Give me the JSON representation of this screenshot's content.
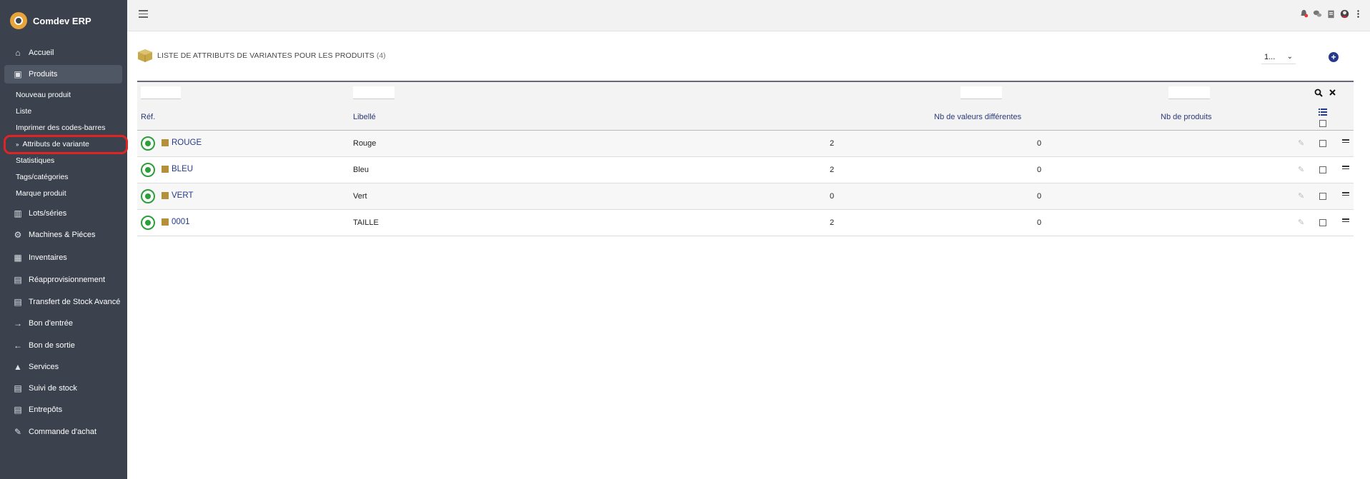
{
  "app": {
    "name": "Comdev ERP"
  },
  "sidebar": {
    "items": [
      {
        "label": "Accueil",
        "icon": "home-icon"
      },
      {
        "label": "Produits",
        "icon": "cube-icon",
        "active": true
      },
      {
        "label": "Lots/séries",
        "icon": "barcode-icon"
      },
      {
        "label": "Machines & Piéces",
        "icon": "cogs-icon"
      },
      {
        "label": "Inventaires",
        "icon": "boxes-icon"
      },
      {
        "label": "Réapprovisionnement",
        "icon": "box-open-icon"
      },
      {
        "label": "Transfert de Stock Avancé",
        "icon": "box-open-icon"
      },
      {
        "label": "Bon d'entrée",
        "icon": "arrow-right-icon"
      },
      {
        "label": "Bon de sortie",
        "icon": "arrow-left-icon"
      },
      {
        "label": "Services",
        "icon": "bell-icon"
      },
      {
        "label": "Suivi de stock",
        "icon": "box-open-icon"
      },
      {
        "label": "Entrepôts",
        "icon": "box-open-icon"
      },
      {
        "label": "Commande d'achat",
        "icon": "dolly-icon"
      }
    ],
    "sub_items": [
      {
        "label": "Nouveau produit"
      },
      {
        "label": "Liste"
      },
      {
        "label": "Imprimer des codes-barres"
      },
      {
        "label": "Attributs de variante",
        "current": true
      },
      {
        "label": "Statistiques"
      },
      {
        "label": "Tags/catégories"
      },
      {
        "label": "Marque produit"
      }
    ]
  },
  "page": {
    "title": "LISTE DE ATTRIBUTS DE VARIANTES POUR LES PRODUITS",
    "count": "(4)",
    "per_page": "1...",
    "add_symbol": "+"
  },
  "table": {
    "columns": [
      "Réf.",
      "Libellé",
      "Nb de valeurs différentes",
      "Nb de produits"
    ],
    "rows": [
      {
        "ref": "ROUGE",
        "label": "Rouge",
        "nb_values": "2",
        "nb_products": "0"
      },
      {
        "ref": "BLEU",
        "label": "Bleu",
        "nb_values": "2",
        "nb_products": "0"
      },
      {
        "ref": "VERT",
        "label": "Vert",
        "nb_values": "0",
        "nb_products": "0"
      },
      {
        "ref": "0001",
        "label": "TAILLE",
        "nb_values": "2",
        "nb_products": "0"
      }
    ]
  },
  "colors": {
    "sidebar_bg": "#3b414d",
    "accent": "#253a8a",
    "whatsapp": "#2c9e3a",
    "product_icon": "#b58f3a",
    "highlight": "#e02424"
  }
}
